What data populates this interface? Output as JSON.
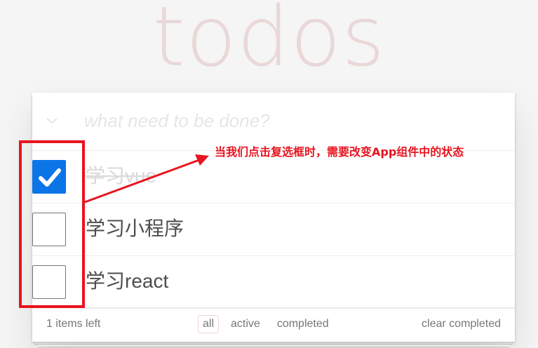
{
  "app": {
    "title": "todos"
  },
  "new_todo": {
    "placeholder": "what need to be done?",
    "toggle_icon": "chevron-down-icon"
  },
  "todos": [
    {
      "title": "学习vue",
      "completed": true
    },
    {
      "title": "学习小程序",
      "completed": false
    },
    {
      "title": "学习react",
      "completed": false
    }
  ],
  "footer": {
    "count_text": "1 items left",
    "filters": [
      "all",
      "active",
      "completed"
    ],
    "selected_filter": "all",
    "clear_label": "clear completed"
  },
  "annotation": {
    "text": "当我们点击复选框时，需要改变App组件中的状态",
    "color": "#e8141f"
  },
  "colors": {
    "checkbox_checked": "#0b75e8",
    "title": "rgba(175,47,47,0.15)"
  }
}
